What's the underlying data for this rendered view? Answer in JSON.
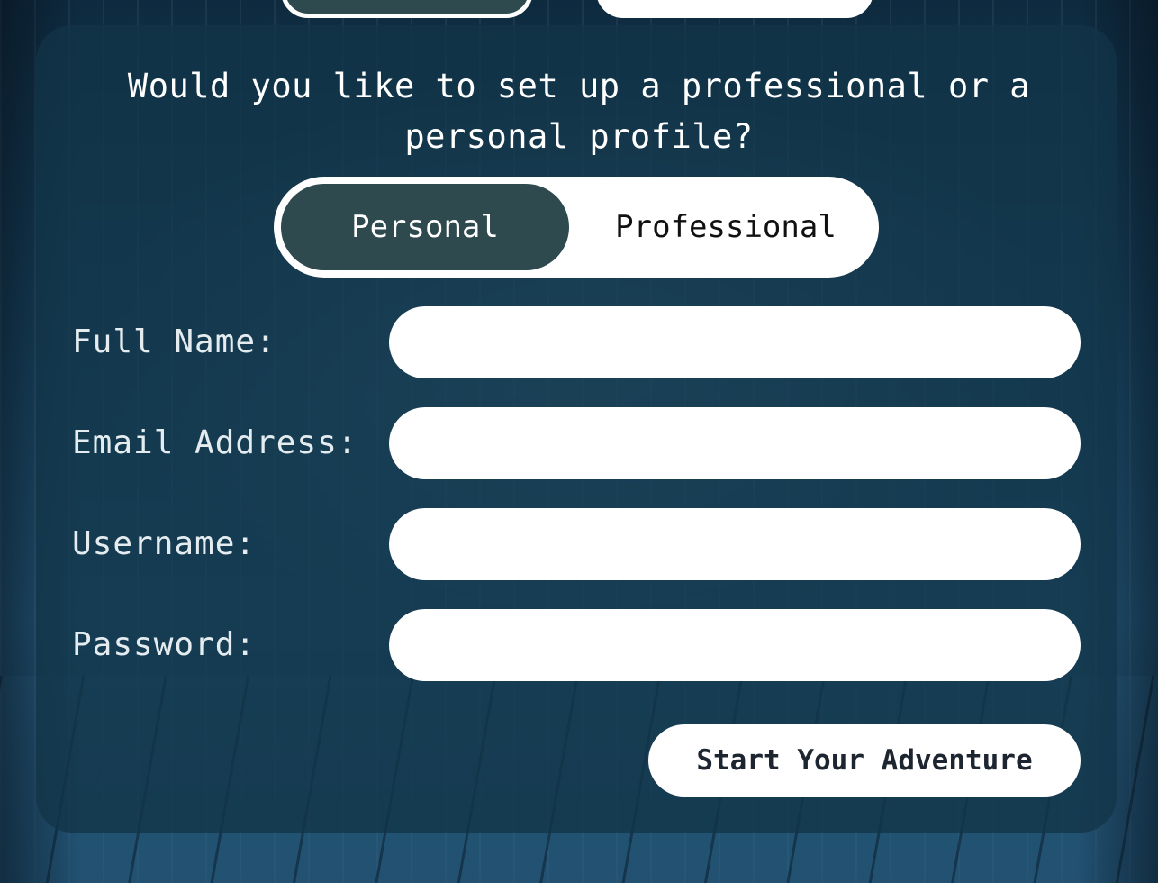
{
  "question": "Would you like to set up a professional or a personal profile?",
  "profile_toggle": {
    "options": [
      "Personal",
      "Professional"
    ],
    "selected": "Personal"
  },
  "form": {
    "fields": [
      {
        "label": "Full Name:",
        "value": "",
        "placeholder": ""
      },
      {
        "label": "Email Address:",
        "value": "",
        "placeholder": ""
      },
      {
        "label": "Username:",
        "value": "",
        "placeholder": ""
      },
      {
        "label": "Password:",
        "value": "",
        "placeholder": ""
      }
    ],
    "submit_label": "Start Your Adventure"
  },
  "colors": {
    "card_bg": "#12344880",
    "toggle_selected": "#2e4a4e",
    "input_bg": "#ffffff",
    "label_text": "#e4ecf0"
  }
}
